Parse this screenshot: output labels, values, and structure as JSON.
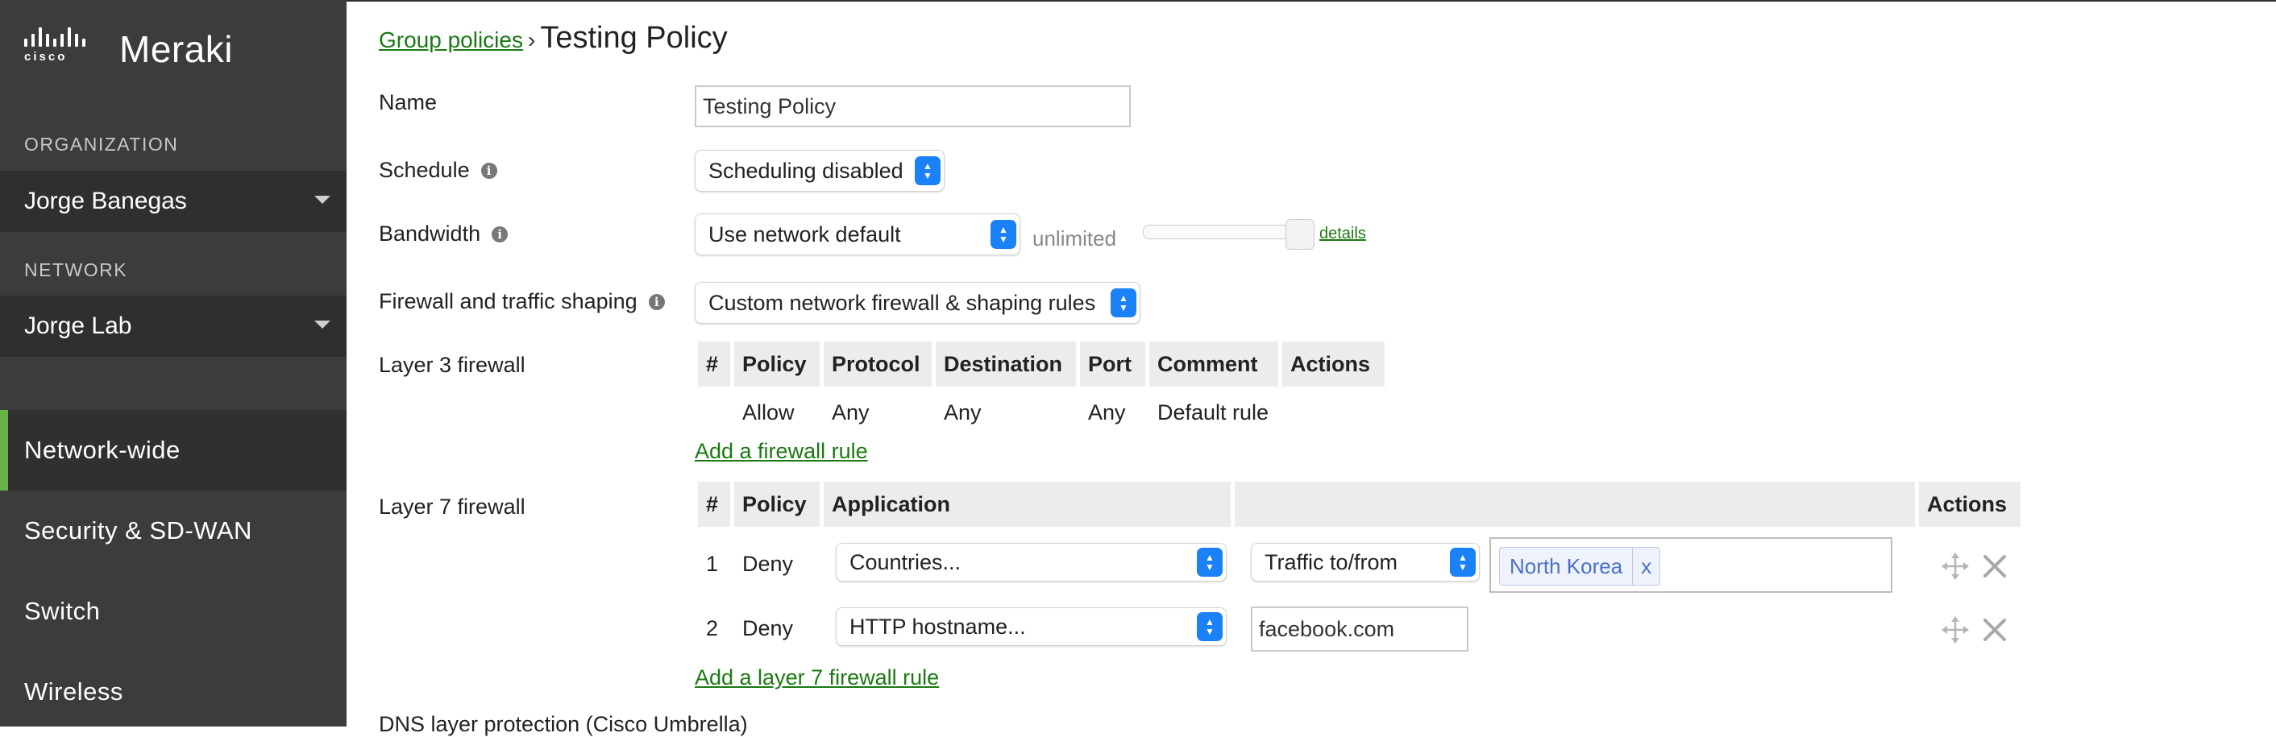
{
  "brand": {
    "company": "cisco",
    "product": "Meraki"
  },
  "sidebar": {
    "organization_label": "ORGANIZATION",
    "organization_value": "Jorge Banegas",
    "network_label": "NETWORK",
    "network_value": "Jorge Lab",
    "nav": [
      {
        "label": "Network-wide",
        "active": true
      },
      {
        "label": "Security & SD-WAN"
      },
      {
        "label": "Switch"
      },
      {
        "label": "Wireless"
      }
    ]
  },
  "breadcrumb": {
    "parent": "Group policies",
    "separator": "›",
    "current": "Testing Policy"
  },
  "form": {
    "name_label": "Name",
    "name_value": "Testing Policy",
    "schedule_label": "Schedule",
    "schedule_value": "Scheduling disabled",
    "bandwidth_label": "Bandwidth",
    "bandwidth_value": "Use network default",
    "bandwidth_limit": "unlimited",
    "details_link": "details",
    "firewall_label": "Firewall and traffic shaping",
    "firewall_value": "Custom network firewall & shaping rules",
    "l3_label": "Layer 3 firewall",
    "l7_label": "Layer 7 firewall",
    "next_section_partial": "DNS layer protection (Cisco Umbrella)"
  },
  "layer3": {
    "headers": [
      "#",
      "Policy",
      "Protocol",
      "Destination",
      "Port",
      "Comment",
      "Actions"
    ],
    "rows": [
      {
        "num": "",
        "policy": "Allow",
        "protocol": "Any",
        "destination": "Any",
        "port": "Any",
        "comment": "Default rule"
      }
    ],
    "add_link": "Add a firewall rule"
  },
  "layer7": {
    "headers": [
      "#",
      "Policy",
      "Application",
      "",
      "Actions"
    ],
    "rows": [
      {
        "num": "1",
        "policy": "Deny",
        "application": "Countries...",
        "direction": "Traffic to/from",
        "tag": "North Korea",
        "tag_remove": "x"
      },
      {
        "num": "2",
        "policy": "Deny",
        "application": "HTTP hostname...",
        "value": "facebook.com"
      }
    ],
    "add_link": "Add a layer 7 firewall rule"
  },
  "colors": {
    "sidebar_bg": "#3c3c3d",
    "active_accent": "#67b346",
    "link_green": "#1a7a12",
    "select_blue": "#1a82f6"
  }
}
